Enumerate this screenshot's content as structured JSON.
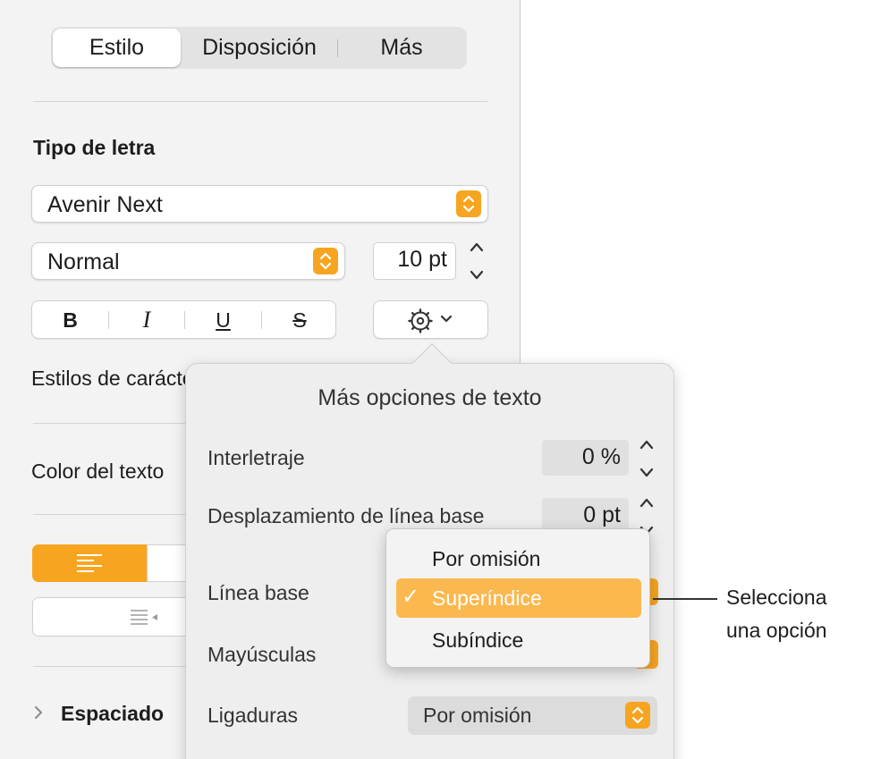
{
  "tabs": [
    {
      "label": "Estilo",
      "active": true
    },
    {
      "label": "Disposición",
      "active": false
    },
    {
      "label": "Más",
      "active": false
    }
  ],
  "font": {
    "section_label": "Tipo de letra",
    "family": "Avenir Next",
    "typeface": "Normal",
    "size": "10 pt"
  },
  "format_buttons": {
    "bold": "B",
    "italic": "I",
    "underline": "U",
    "strikethrough": "S"
  },
  "sidebar_labels": {
    "character_styles": "Estilos de carácter",
    "text_color": "Color del texto",
    "spacing": "Espaciado"
  },
  "popover": {
    "title": "Más opciones de texto",
    "tracking_label": "Interletraje",
    "tracking_value": "0 %",
    "baseline_shift_label": "Desplazamiento de línea base",
    "baseline_shift_value": "0 pt",
    "baseline_label": "Línea base",
    "capitalization_label": "Mayúsculas",
    "ligatures_label": "Ligaduras",
    "ligatures_value": "Por omisión"
  },
  "baseline_menu": {
    "items": [
      "Por omisión",
      "Superíndice",
      "Subíndice"
    ],
    "selected": "Superíndice",
    "checkmark": "✓"
  },
  "callout": {
    "line1": "Selecciona",
    "line2": "una opción"
  },
  "colors": {
    "accent": "#f7a520",
    "selection": "#fbb84f"
  }
}
